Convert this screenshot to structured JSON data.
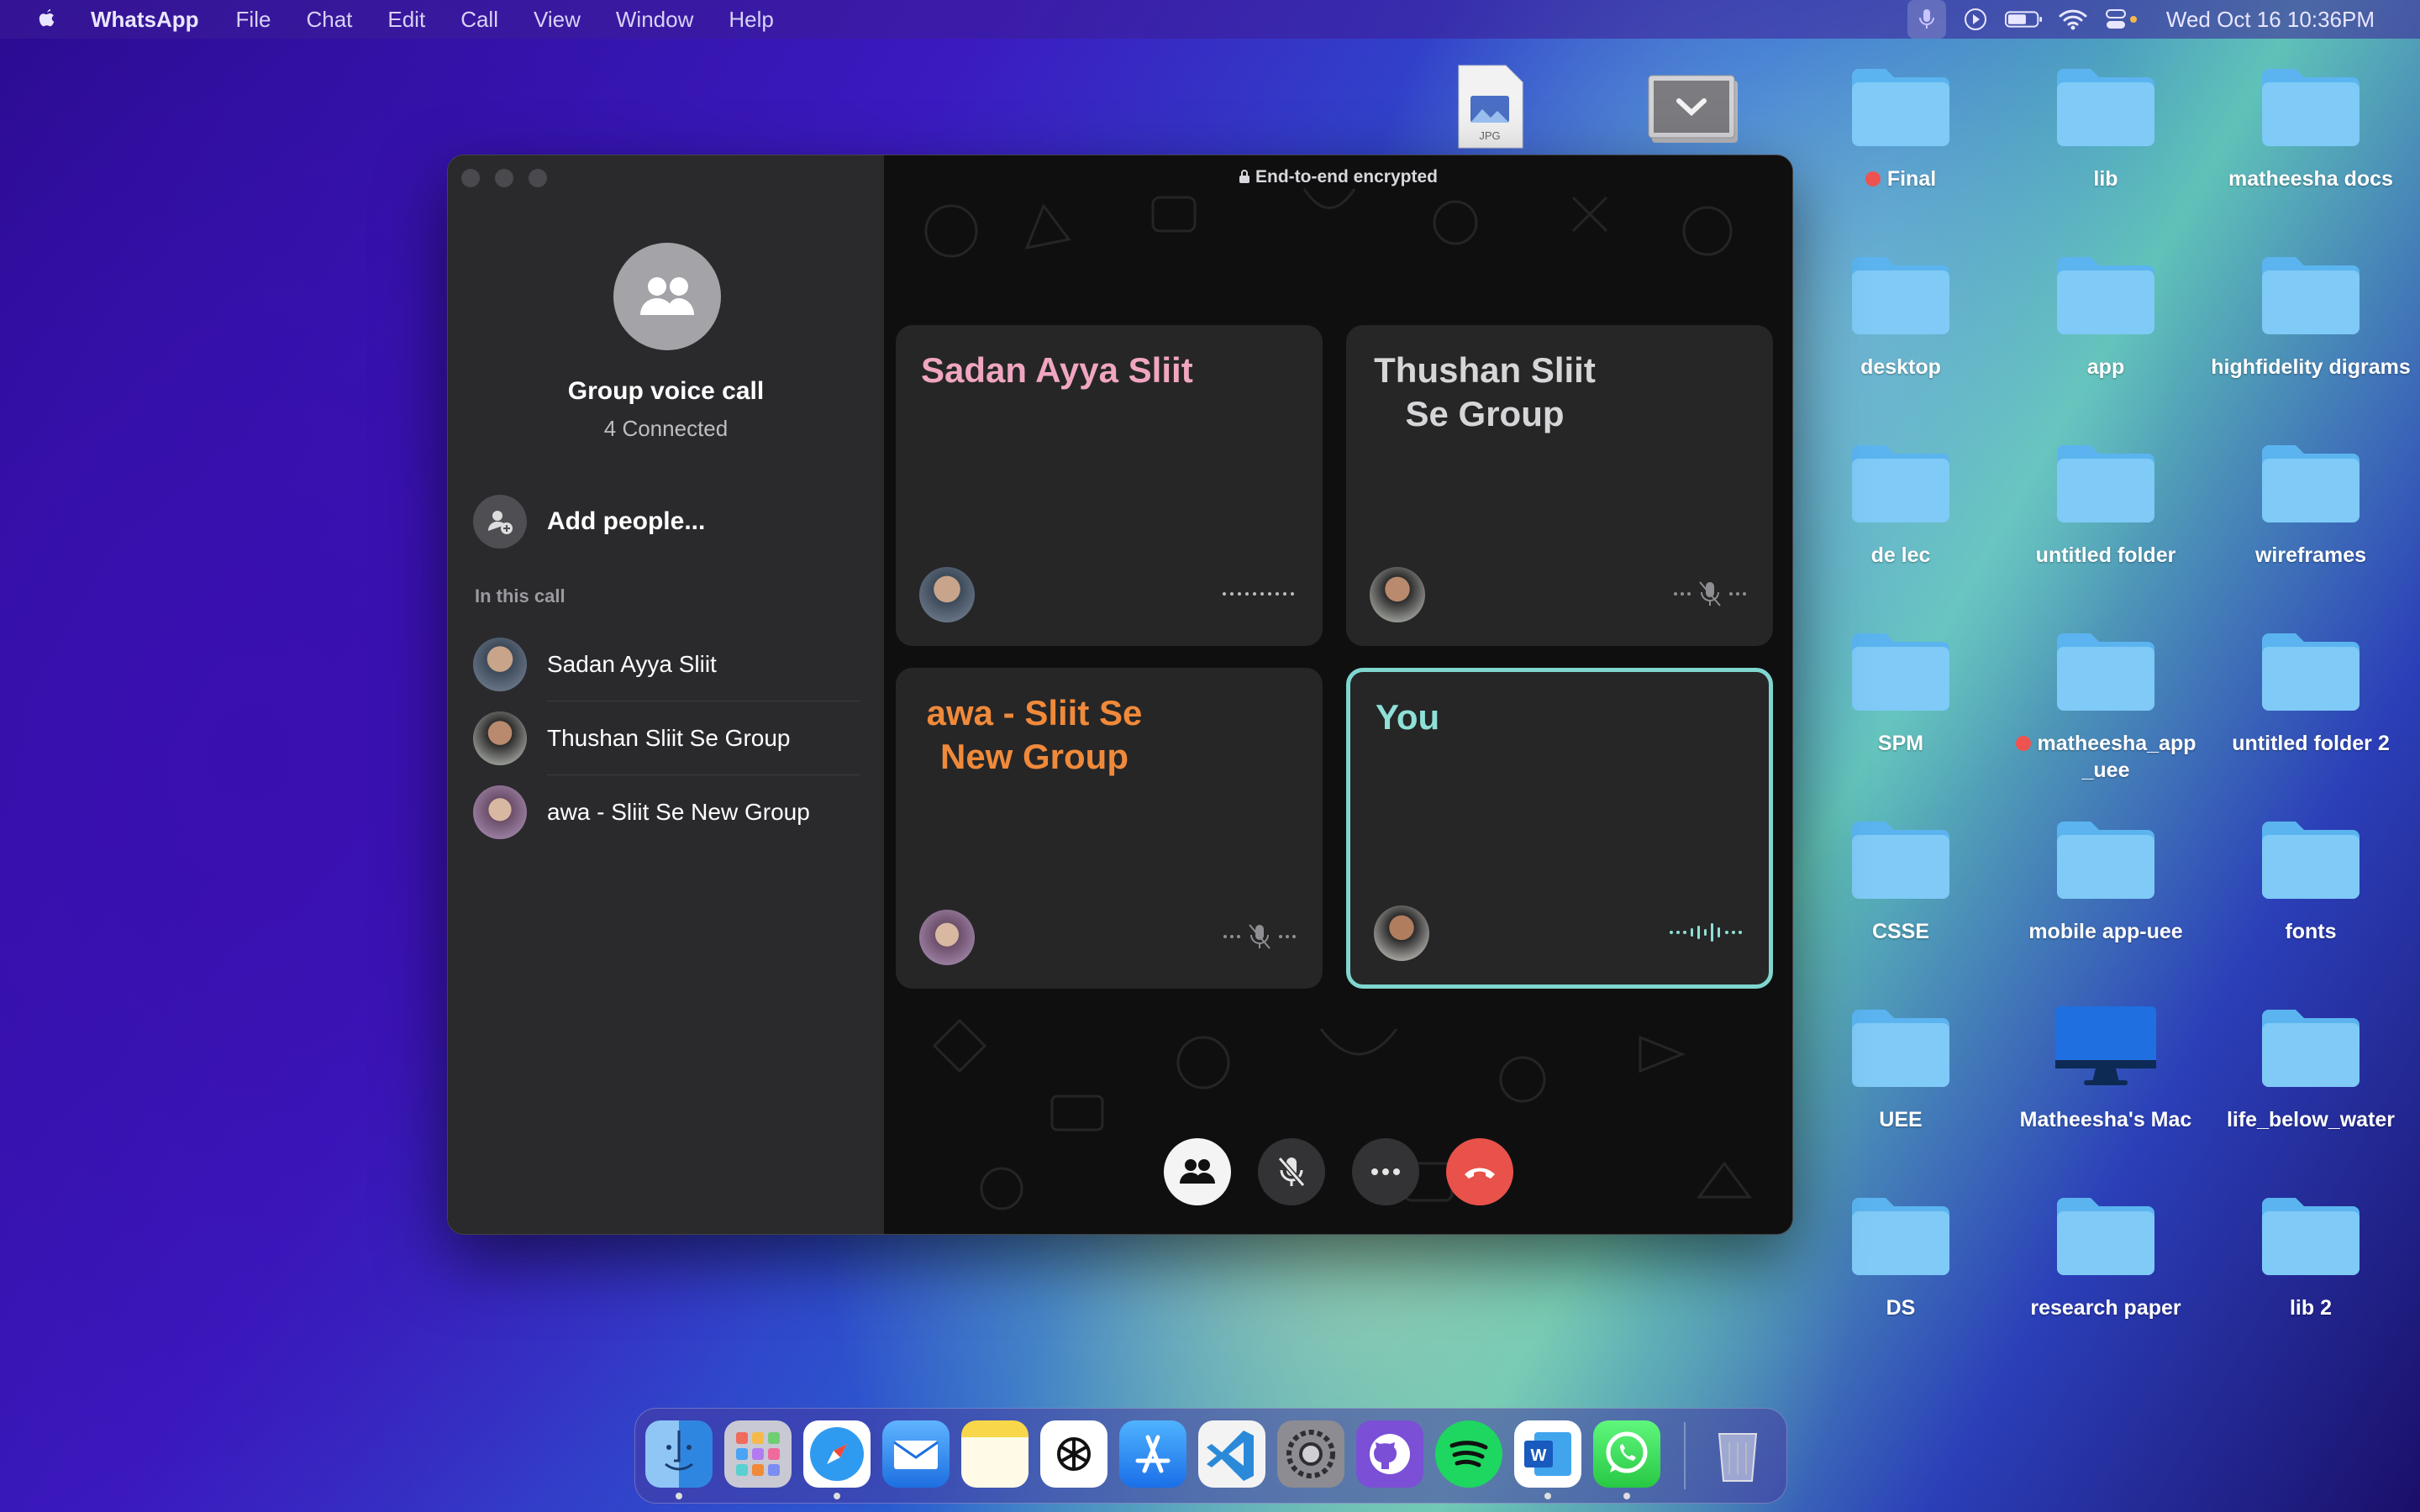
{
  "menubar": {
    "app_name": "WhatsApp",
    "menus": [
      "File",
      "Chat",
      "Edit",
      "Call",
      "View",
      "Window",
      "Help"
    ],
    "datetime": "Wed Oct 16  10:36PM"
  },
  "desktop": {
    "thumb_label": "JPG",
    "items": [
      {
        "label": "Final",
        "tag": "red"
      },
      {
        "label": "lib"
      },
      {
        "label": "matheesha docs"
      },
      {
        "label": "desktop"
      },
      {
        "label": "app"
      },
      {
        "label": "highfidelity digrams"
      },
      {
        "label": "de lec"
      },
      {
        "label": "untitled folder"
      },
      {
        "label": "wireframes"
      },
      {
        "label": "SPM"
      },
      {
        "label": "matheesha_app _uee",
        "tag": "red"
      },
      {
        "label": "untitled folder 2"
      },
      {
        "label": "CSSE"
      },
      {
        "label": "mobile app-uee"
      },
      {
        "label": "fonts"
      },
      {
        "label": "UEE"
      },
      {
        "label": "Matheesha's Mac"
      },
      {
        "label": "life_below_water"
      },
      {
        "label": "DS"
      },
      {
        "label": "research paper"
      },
      {
        "label": "lib 2"
      }
    ]
  },
  "call": {
    "encryption_note": "End-to-end encrypted",
    "title": "Group voice call",
    "status": "4 Connected",
    "add_people": "Add people...",
    "section_label": "In this call",
    "participants": [
      {
        "name": "Sadan Ayya Sliit"
      },
      {
        "name": "Thushan Sliit Se Group"
      },
      {
        "name": "awa - Sliit Se New Group"
      }
    ],
    "tiles": [
      {
        "name": "Sadan Ayya Sliit",
        "color": "#f0a6c0",
        "status": "speaking"
      },
      {
        "name": "Thushan Sliit Se Group",
        "color": "#d6d6d8",
        "status": "muted"
      },
      {
        "name": "awa - Sliit Se New Group",
        "color": "#f08a3a",
        "status": "muted"
      },
      {
        "name": "You",
        "color": "#8fe0d6",
        "status": "active",
        "highlight": "#7fd6cf"
      }
    ],
    "controls": [
      "participants-icon",
      "mic-muted-icon",
      "more-icon",
      "end-call-icon"
    ],
    "end_call_color": "#e8524a"
  },
  "dock": {
    "apps": [
      "Finder",
      "Launchpad",
      "Safari",
      "Mail",
      "Notes",
      "ChatGPT",
      "App Store",
      "Visual Studio Code",
      "System Settings",
      "GitHub Desktop",
      "Spotify",
      "Microsoft Word",
      "WhatsApp",
      "Trash"
    ]
  }
}
